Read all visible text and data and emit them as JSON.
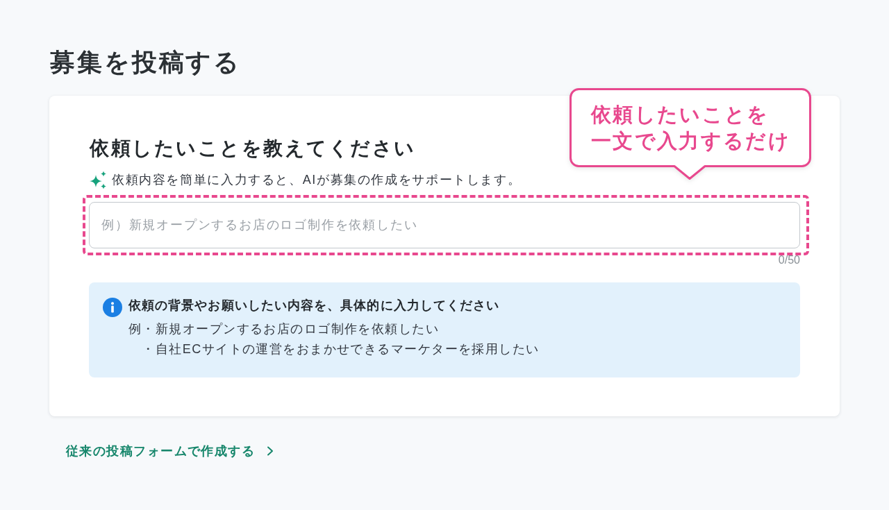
{
  "page": {
    "title": "募集を投稿する"
  },
  "form_card": {
    "heading": "依頼したいことを教えてください",
    "hint": "依頼内容を簡単に入力すると、AIが募集の作成をサポートします。",
    "request_field": {
      "placeholder": "例）新規オープンするお店のロゴ制作を依頼したい",
      "counter": "0/50"
    },
    "info_box": {
      "title": "依頼の背景やお願いしたい内容を、具体的に入力してください",
      "example_label": "例",
      "examples": [
        "・新規オープンするお店のロゴ制作を依頼したい",
        "・自社ECサイトの運営をおまかせできるマーケターを採用したい"
      ]
    }
  },
  "callout": {
    "lines": [
      "依頼したいことを",
      "一文で入力するだけ"
    ]
  },
  "legacy_link": {
    "label": "従来の投稿フォームで作成する"
  }
}
